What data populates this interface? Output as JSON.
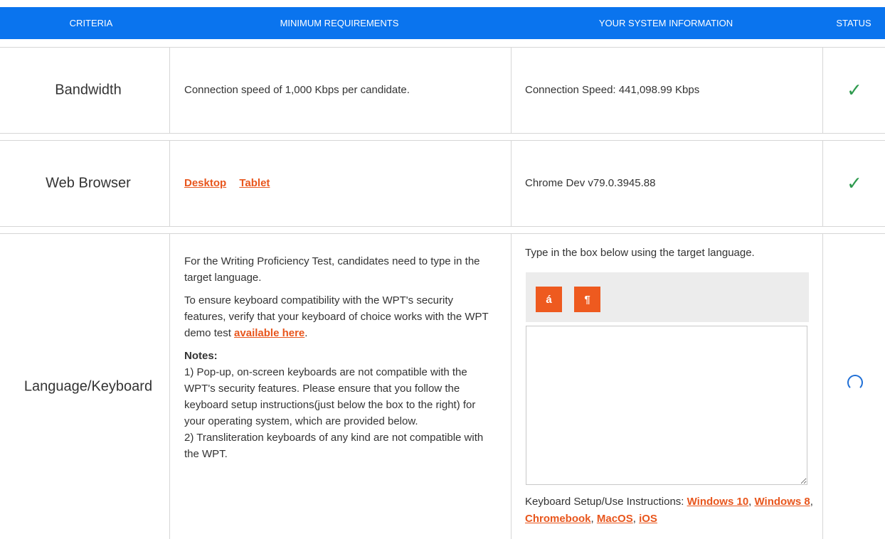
{
  "header": {
    "criteria": "CRITERIA",
    "minimum": "MINIMUM REQUIREMENTS",
    "system": "YOUR SYSTEM INFORMATION",
    "status": "STATUS"
  },
  "rows": {
    "bandwidth": {
      "criteria": "Bandwidth",
      "requirement": "Connection speed of 1,000 Kbps per candidate.",
      "system": "Connection Speed: 441,098.99 Kbps",
      "status": "ok"
    },
    "browser": {
      "criteria": "Web Browser",
      "link_desktop": "Desktop",
      "link_tablet": "Tablet",
      "system": "Chrome Dev v79.0.3945.88",
      "status": "ok"
    },
    "keyboard": {
      "criteria": "Language/Keyboard",
      "para1": "For the Writing Proficiency Test, candidates need to type in the target language.",
      "para2_text": "To ensure keyboard compatibility with the WPT's security features, verify that your keyboard of choice works with the WPT demo test ",
      "para2_link": "available here",
      "para2_end": ".",
      "notes_label": "Notes:",
      "note1": "1) Pop-up, on-screen keyboards are not compatible with the WPT's security features. Please ensure that you follow the keyboard setup instructions(just below the box to the right) for your operating system, which are provided below.",
      "note2": "2) Transliteration keyboards of any kind are not compatible with the WPT.",
      "instruction": "Type in the box below using the target language.",
      "btn_accent": "á",
      "btn_rtl": "¶",
      "setup_label": "Keyboard Setup/Use Instructions: ",
      "setup_links": {
        "win10": "Windows 10",
        "win8": "Windows 8",
        "chromebook": "Chromebook",
        "macos": "MacOS",
        "ios": "iOS"
      },
      "sep": ", ",
      "status": "loading"
    }
  },
  "colors": {
    "header_bg": "#0a74ee",
    "link": "#e8561d",
    "check": "#2e9a4e",
    "spinner": "#1f6fd6",
    "button": "#ee5a1f"
  }
}
